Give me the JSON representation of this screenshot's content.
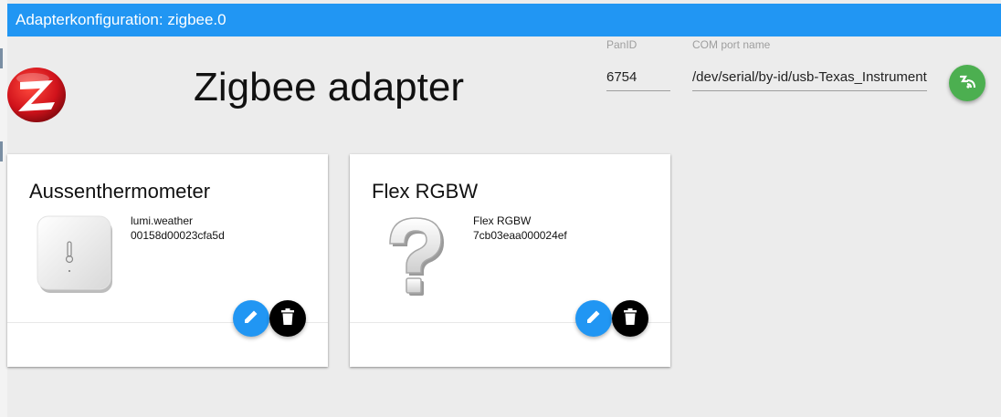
{
  "window": {
    "title": "Adapterkonfiguration: zigbee.0"
  },
  "header": {
    "title": "Zigbee adapter",
    "logo_icon": "zigbee-logo-icon"
  },
  "settings": {
    "panid": {
      "label": "PanID",
      "value": "6754"
    },
    "com_port": {
      "label": "COM port name",
      "value": "/dev/serial/by-id/usb-Texas_Instruments"
    },
    "pair_button_icon": "wireless-pairing-icon"
  },
  "devices": [
    {
      "name": "Aussenthermometer",
      "model": "lumi.weather",
      "id": "00158d00023cfa5d",
      "image_icon": "temperature-sensor-icon"
    },
    {
      "name": "Flex RGBW",
      "model": "Flex RGBW",
      "id": "7cb03eaa000024ef",
      "image_icon": "unknown-device-question-icon"
    }
  ],
  "colors": {
    "accent": "#2196f3",
    "pair_button": "#4caf50",
    "delete_button": "#000000",
    "background": "#ececec"
  }
}
